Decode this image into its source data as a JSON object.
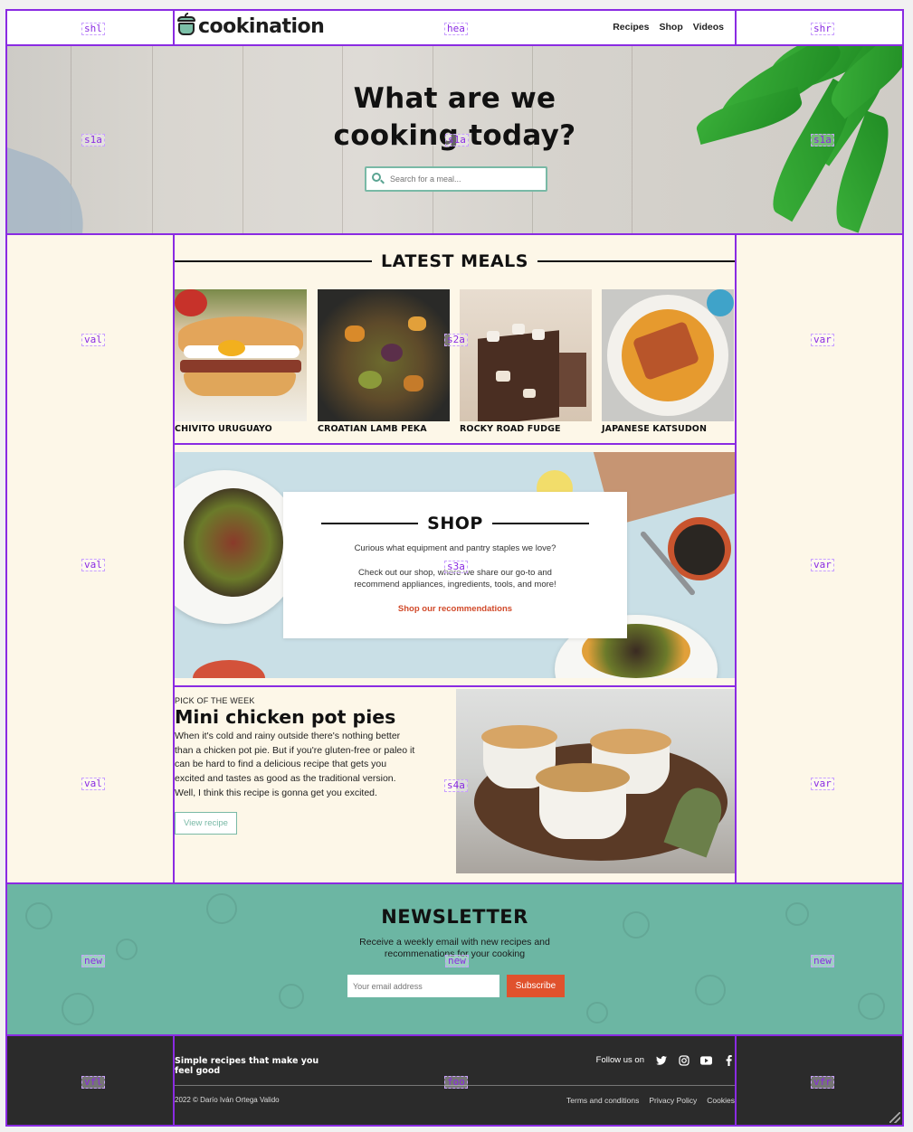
{
  "brand": {
    "name": "cookination"
  },
  "nav": {
    "items": [
      "Recipes",
      "Shop",
      "Videos"
    ]
  },
  "hero": {
    "title_line1": "What are we",
    "title_line2": "cooking today?",
    "search_placeholder": "Search for a meal..."
  },
  "latest": {
    "heading": "LATEST MEALS",
    "meals": [
      "CHIVITO URUGUAYO",
      "CROATIAN LAMB PEKA",
      "ROCKY ROAD FUDGE",
      "JAPANESE KATSUDON"
    ]
  },
  "shop": {
    "heading": "SHOP",
    "line1": "Curious what equipment and pantry staples we love?",
    "line2": "Check out our shop, where we share our go-to and",
    "line3": "recommend appliances, ingredients, tools, and more!",
    "link": "Shop our recommendations"
  },
  "pick": {
    "tag": "PICK OF THE WEEK",
    "title": "Mini chicken pot pies",
    "description": "When it's cold and rainy outside there's nothing better than a chicken pot pie. But if you're gluten-free or paleo it can be hard to find a delicious recipe that gets you excited and tastes as good as the traditional version. Well, I think this recipe is gonna get you excited.",
    "button": "View recipe"
  },
  "newsletter": {
    "heading": "NEWSLETTER",
    "desc_line1": "Receive a weekly email with new recipes and",
    "desc_line2": "recommenations for your cooking",
    "email_placeholder": "Your email address",
    "button": "Subscribe"
  },
  "footer": {
    "tagline": "Simple recipes that make you feel good",
    "follow": "Follow us on",
    "social_icons": [
      "twitter-icon",
      "instagram-icon",
      "youtube-icon",
      "facebook-icon"
    ],
    "copyright": "2022 © Darío Iván Ortega Valido",
    "links": [
      "Terms and conditions",
      "Privacy Policy",
      "Cookies"
    ]
  },
  "grid_labels": {
    "shl": "shl",
    "hea": "hea",
    "shr": "shr",
    "s1a": "s1a",
    "val": "val",
    "s2a": "s2a",
    "var": "var",
    "s3a": "s3a",
    "s4a": "s4a",
    "new": "new",
    "vfl": "vfl",
    "foo": "foo",
    "vfr": "vfr"
  },
  "colors": {
    "accent": "#79b9a6",
    "cream": "#fdf7e8",
    "newsletter": "#6cb6a3",
    "cta": "#e0522d",
    "footer": "#2b2b2b",
    "grid": "#8a2be2"
  }
}
